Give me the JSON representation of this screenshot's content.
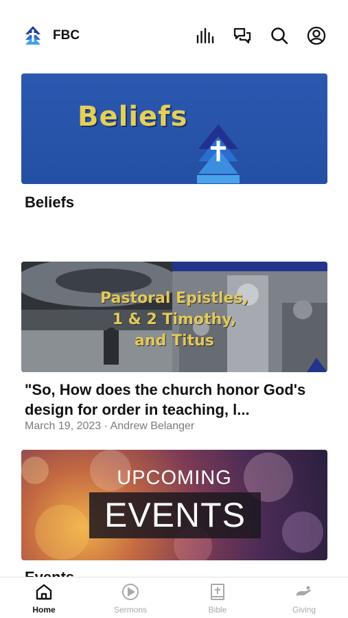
{
  "header": {
    "app_title": "FBC",
    "icons": [
      "church-logo-icon",
      "audio-bars-icon",
      "chat-icon",
      "search-icon",
      "account-icon"
    ]
  },
  "cards": [
    {
      "banner_text": "Beliefs",
      "title": "Beliefs"
    },
    {
      "banner_lines": [
        "Pastoral Epistles,",
        "1 & 2 Timothy,",
        "and Titus"
      ],
      "title": "\"So, How does the church honor God's design for order in teaching, l...",
      "meta": "March 19, 2023 · Andrew Belanger"
    },
    {
      "banner_line1": "UPCOMING",
      "banner_line2": "EVENTS",
      "title": "Events"
    }
  ],
  "tabbar": {
    "tabs": [
      {
        "label": "Home",
        "icon": "home-icon",
        "active": true
      },
      {
        "label": "Sermons",
        "icon": "play-circle-icon",
        "active": false
      },
      {
        "label": "Bible",
        "icon": "bible-icon",
        "active": false
      },
      {
        "label": "Giving",
        "icon": "giving-hand-icon",
        "active": false
      }
    ]
  },
  "colors": {
    "accent": "#2450a3",
    "banner_gold": "#e4cf5a",
    "inactive_tab": "#a8a8a8"
  }
}
